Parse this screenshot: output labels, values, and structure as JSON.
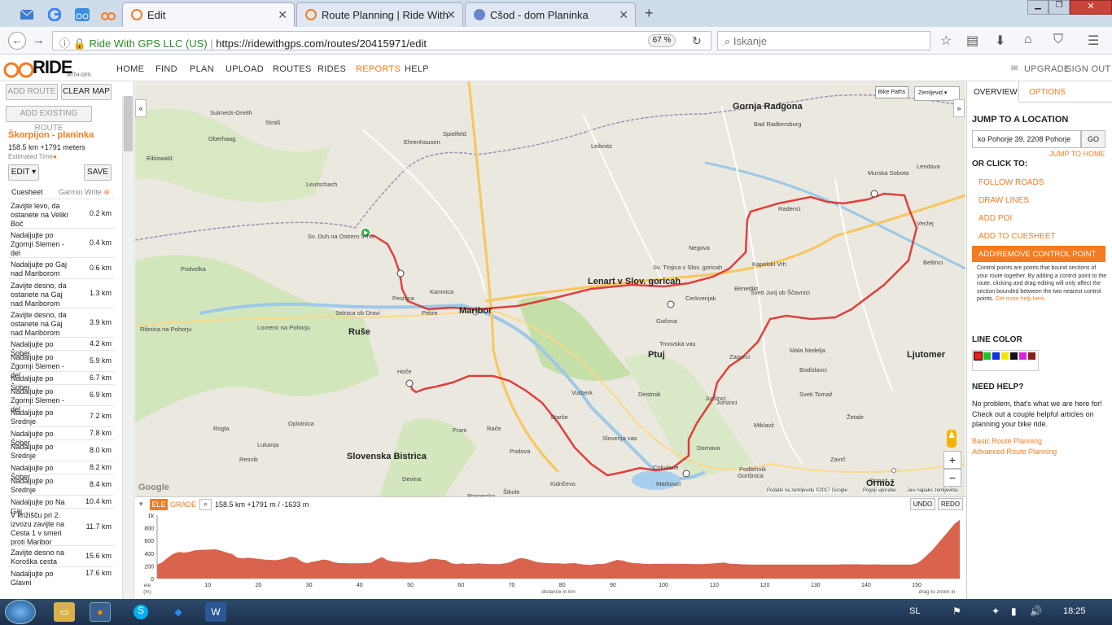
{
  "browser": {
    "tabs": [
      {
        "label": "Edit",
        "active": true
      },
      {
        "label": "Route Planning | Ride With"
      },
      {
        "label": "Cšod - dom Planinka"
      }
    ],
    "url_site": "Ride With GPS LLC (US)",
    "url": "https://ridewithgps.com/routes/20415971/edit",
    "zoom": "67 %",
    "search_placeholder": "Iskanje"
  },
  "site": {
    "logo_main": "RIDE",
    "logo_sub": "WITH GPS",
    "nav": [
      "HOME",
      "FIND",
      "PLAN",
      "UPLOAD",
      "ROUTES",
      "RIDES",
      "REPORTS",
      "HELP"
    ],
    "upgrade": "UPGRADE",
    "signout": "SIGN OUT"
  },
  "left": {
    "add_route": "ADD ROUTE",
    "clear_map": "CLEAR MAP",
    "add_existing": "ADD EXISTING ROUTE",
    "route_name": "Škorpijon - planinka",
    "route_stats": "158.5 km +1791 meters",
    "estimated_time": "Estimated Time",
    "edit": "EDIT",
    "save": "SAVE",
    "cuesheet": "Cuesheet",
    "garmin": "Garmin Write",
    "cues": [
      {
        "text": "Zavijte levo, da ostanete na Veliki Boč",
        "dist": "0.2 km"
      },
      {
        "text": "Nadaljujte po Zgornji Slemen - del",
        "dist": "0.4 km"
      },
      {
        "text": "Nadaljujte po Gaj nad Mariborom",
        "dist": "0.6 km"
      },
      {
        "text": "Zavijte desno, da ostanete na Gaj nad Mariborom",
        "dist": "1.3 km"
      },
      {
        "text": "Zavijte desno, da ostanete na Gaj nad Mariborom",
        "dist": "3.9 km"
      },
      {
        "text": "Nadaljujte po Šober",
        "dist": "4.2 km"
      },
      {
        "text": "Nadaljujte po Zgornji Slemen - del",
        "dist": "5.9 km"
      },
      {
        "text": "Nadaljujte po Šober",
        "dist": "6.7 km"
      },
      {
        "text": "Nadaljujte po Zgornji Slemen - del",
        "dist": "6.9 km"
      },
      {
        "text": "Nadaljujte po Srednje",
        "dist": "7.2 km"
      },
      {
        "text": "Nadaljujte po Šober",
        "dist": "7.8 km"
      },
      {
        "text": "Nadaljujte po Srednje",
        "dist": "8.0 km"
      },
      {
        "text": "Nadaljujte po Šober",
        "dist": "8.2 km"
      },
      {
        "text": "Nadaljujte po Srednje",
        "dist": "8.4 km"
      },
      {
        "text": "Nadaljujte po Na Gaj",
        "dist": "10.4 km"
      },
      {
        "text": "V križišču pri 2. izvozu zavijte na Cesta 1 v smeri proti Maribor",
        "dist": "11.7 km"
      },
      {
        "text": "Zavijte desno na Koroška cesta",
        "dist": "15.6 km"
      },
      {
        "text": "Nadaljujte po Glavni",
        "dist": "17.6 km"
      }
    ]
  },
  "map": {
    "bike_paths": "Bike Paths",
    "map_type": "Zemljevid",
    "copyright": "Podatki na zemljevidu ©2017 Google",
    "terms": "Pogoji uporabe",
    "report": "Javi napako zemljevida",
    "google": "Google",
    "towns": [
      "Maribor",
      "Ptuj",
      "Ormož",
      "Ljutomer",
      "Gornja Radgona",
      "Lenart v Slov. goricah",
      "Slovenska Bistrica",
      "Ruše",
      "Spielfeld",
      "Leibnitz",
      "Sv. Duh na Ostrem Vrhu",
      "Kamnica",
      "Hoče",
      "Rače",
      "Kidričevo",
      "Cirkulane",
      "Dornava",
      "Zavrč",
      "Ormož",
      "Murska Sobota",
      "Radenci",
      "Kapelski Vrh",
      "Cerkvenjak",
      "Sveti Jurij ob Ščavnici",
      "Jursinci",
      "Destrnik",
      "Markovci",
      "Gorišnica",
      "Juršinci",
      "Vurberk",
      "Starše",
      "Miklavž",
      "Pesnica",
      "Pekre",
      "Selnica ob Dravi",
      "Podvelka",
      "Ribnica na Pohorju",
      "Lovrenc na Pohorju",
      "Fram",
      "Oplotnica",
      "Sulmeck-Greith",
      "Eibiswald",
      "Oberhaag",
      "Leutschach",
      "Ehrenhausen",
      "Straß",
      "Bad Radkersburg",
      "Lendava",
      "Beltinci",
      "Veržej",
      "Mala Nedelja",
      "Bodislavci",
      "Negova",
      "Benedikt",
      "Sv. Trojica v Slov. goricah",
      "Gočova",
      "Trnovska vas",
      "Zagorci",
      "Sveti Tomaž",
      "Žetale",
      "Podlehnik",
      "Slovenja vas",
      "Šikole",
      "Podova",
      "Lukanja",
      "Rogla",
      "Resnik",
      "Devina",
      "Pragersko"
    ]
  },
  "elevation": {
    "tab_ele": "ELE",
    "tab_grade": "GRADE",
    "summary": "158.5 km +1791 m / -1633 m",
    "undo": "UNDO",
    "redo": "REDO",
    "y_ticks": [
      "1k",
      "800",
      "600",
      "400",
      "200",
      "0"
    ],
    "x_ticks": [
      "10",
      "20",
      "30",
      "40",
      "50",
      "60",
      "70",
      "80",
      "90",
      "100",
      "110",
      "120",
      "130",
      "140",
      "150"
    ],
    "ele_label": "ele",
    "m_label": "(m)",
    "x_label": "distance in km",
    "drag_label": "drag to zoom in",
    "profile": [
      220,
      260,
      330,
      390,
      420,
      410,
      420,
      445,
      452,
      455,
      458,
      460,
      440,
      410,
      390,
      330,
      320,
      330,
      320,
      310,
      300,
      295,
      290,
      300,
      320,
      345,
      330,
      270,
      240,
      265,
      280,
      300,
      290,
      260,
      245,
      245,
      240,
      242,
      240,
      245,
      250,
      300,
      340,
      290,
      270,
      265,
      260,
      250,
      255,
      260,
      280,
      310,
      310,
      300,
      290,
      240,
      230,
      240,
      230,
      235,
      240,
      235,
      230,
      230,
      230,
      240,
      260,
      300,
      325,
      310,
      285,
      260,
      250,
      245,
      240,
      240,
      235,
      240,
      245,
      230,
      220,
      215,
      230,
      230,
      240,
      270,
      295,
      285,
      260,
      245,
      240,
      232,
      230,
      232,
      232,
      234,
      232,
      233,
      232,
      231,
      230,
      228,
      230,
      232,
      240,
      248,
      252,
      235,
      232,
      226,
      224,
      222,
      220,
      220,
      222,
      220,
      221,
      220,
      220,
      220,
      222,
      220,
      221,
      220,
      220,
      220,
      220,
      222,
      225,
      226,
      225,
      226,
      223,
      222,
      224,
      223,
      222,
      220,
      220,
      221,
      222,
      220,
      240,
      300,
      380,
      460,
      560,
      660,
      760,
      860,
      925
    ]
  },
  "right": {
    "tab_overview": "OVERVIEW",
    "tab_options": "OPTIONS",
    "jump_title": "JUMP TO A LOCATION",
    "jump_value": "ko Pohorje 39, 2208 Pohorje",
    "go": "GO",
    "jump_home": "JUMP TO HOME",
    "or_click": "OR CLICK TO:",
    "follow_roads": "FOLLOW ROADS",
    "draw_lines": "DRAW LINES",
    "add_poi": "ADD POI",
    "add_cuesheet": "ADD TO CUESHEET",
    "add_remove_cp": "ADD/REMOVE CONTROL POINT",
    "cp_help": "Control points are points that bound sections of your route together. By adding a control point to the route, clicking and drag editing will only affect the section bounded between the two nearest control points.",
    "get_help": "Get more help here.",
    "line_color": "LINE COLOR",
    "colors": [
      "#e8201c",
      "#22c31f",
      "#1230e0",
      "#f5e800",
      "#111111",
      "#e020e0",
      "#8a1d1d"
    ],
    "need_help": "NEED HELP?",
    "help_text": "No problem, that's what we are here for! Check out a couple helpful articles on planning your bike ride.",
    "basic": "Basic Route Planning",
    "advanced": "Advanced Route Planning"
  },
  "taskbar": {
    "lang": "SL",
    "time": "18:25"
  }
}
